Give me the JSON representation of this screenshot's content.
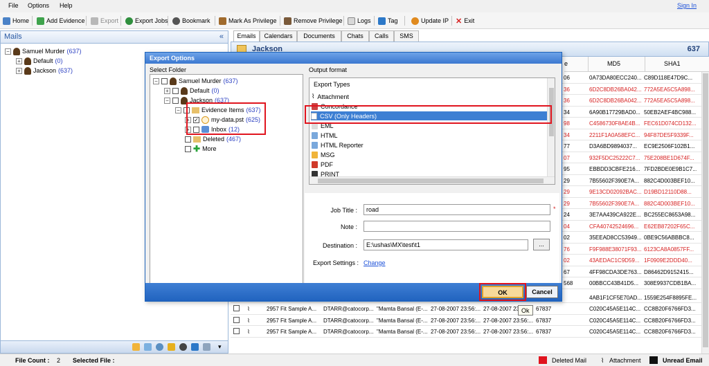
{
  "menu": {
    "file": "File",
    "options": "Options",
    "help": "Help",
    "sign_in": "Sign In"
  },
  "toolbar": {
    "home": "Home",
    "add_evidence": "Add Evidence",
    "export": "Export",
    "export_jobs": "Export Jobs",
    "bookmark": "Bookmark",
    "mark_privilege": "Mark As Privilege",
    "remove_privilege": "Remove Privilege",
    "logs": "Logs",
    "tag": "Tag",
    "update_ip": "Update IP",
    "exit": "Exit"
  },
  "mails": {
    "title": "Mails",
    "collapse": "«",
    "tree": [
      {
        "label": "Samuel Murder",
        "count": "(637)"
      },
      {
        "label": "Default",
        "count": "(0)"
      },
      {
        "label": "Jackson",
        "count": "(637)"
      }
    ]
  },
  "tabs": [
    "Emails",
    "Calendars",
    "Documents",
    "Chats",
    "Calls",
    "SMS"
  ],
  "folder_header": {
    "name": "Jackson",
    "count": "637"
  },
  "grid": {
    "col_e": "e",
    "md5": "MD5",
    "sha1": "SHA1",
    "rows": [
      {
        "size": "06",
        "md5": "0A73DA80ECC240...",
        "sha1": "C89D118E47D9C...",
        "red": false
      },
      {
        "size": "36",
        "md5": "6D2C8DB26BA042...",
        "sha1": "772A5EA5C5A898...",
        "red": true
      },
      {
        "size": "36",
        "md5": "6D2C8DB26BA042...",
        "sha1": "772A5EA5C5A898...",
        "red": true
      },
      {
        "size": "34",
        "md5": "6A90B17729BAD0...",
        "sha1": "50EB2AEF4BC988...",
        "red": false
      },
      {
        "size": "98",
        "md5": "C4586730F8AE4B...",
        "sha1": "FEC61D074CD132...",
        "red": true
      },
      {
        "size": "34",
        "md5": "2211F1A0A58EFC...",
        "sha1": "94F87DE5F9339F...",
        "red": true
      },
      {
        "size": "77",
        "md5": "D3A6BD9894037...",
        "sha1": "EC9E2506F102B1...",
        "red": false
      },
      {
        "size": "07",
        "md5": "932F5DC25222C7...",
        "sha1": "75E208BE1D674F...",
        "red": true
      },
      {
        "size": "95",
        "md5": "EBBDD3CBFE216...",
        "sha1": "7FD2BDE0E9B1C7...",
        "red": false
      },
      {
        "size": "29",
        "md5": "7B55602F390E7A...",
        "sha1": "882C4D003BEF10...",
        "red": false
      },
      {
        "size": "29",
        "md5": "9E13CD02092BAC...",
        "sha1": "D19BD12110D88...",
        "red": true
      },
      {
        "size": "29",
        "md5": "7B55602F390E7A...",
        "sha1": "882C4D003BEF10...",
        "red": true
      },
      {
        "size": "24",
        "md5": "3E7AA439CA922E...",
        "sha1": "BC255EC8653A98...",
        "red": false
      },
      {
        "size": "04",
        "md5": "CFA40742524696...",
        "sha1": "E62EB87202F65C...",
        "red": true
      },
      {
        "size": "02",
        "md5": "35EEAD8CC53949...",
        "sha1": "0BE9C56ABBBC8...",
        "red": false
      },
      {
        "size": "76",
        "md5": "F9F988E38071F93...",
        "sha1": "6123CA8A0857FF...",
        "red": true
      },
      {
        "size": "02",
        "md5": "43AEDAC1C9D59...",
        "sha1": "1F0909E2DDD40...",
        "red": true
      },
      {
        "size": "67",
        "md5": "4FF98CDA3DE763...",
        "sha1": "D86462D9152415...",
        "red": false
      },
      {
        "size": "568",
        "md5": "00BBCC43B41D5...",
        "sha1": "308E9937CDB1BA...",
        "red": false
      }
    ],
    "full_rows": [
      {
        "subject": "1411 Fit Sample A...",
        "from": "JGADD@catocorp...",
        "to": "\"Chandra Ray (E-...",
        "sent": "21-08-2007 23:56...",
        "recv": "21-08-2007 23:56...",
        "size": "73162",
        "md5": "4AB1F1CF5E70AD...",
        "sha1": "1559E254F8895FE..."
      },
      {
        "subject": "2957 Fit Sample A...",
        "from": "DTARR@catocorp...",
        "to": "\"Mamta Bansal (E-...",
        "sent": "27-08-2007 23:56:...",
        "recv": "27-08-2007 23:56:...",
        "size": "67837",
        "md5": "C020C45A5E114C...",
        "sha1": "CC8B20F6766FD3..."
      },
      {
        "subject": "2957 Fit Sample A...",
        "from": "DTARR@catocorp...",
        "to": "\"Mamta Bansal (E-...",
        "sent": "27-08-2007 23:56:...",
        "recv": "27-08-2007 23:56:...",
        "size": "67837",
        "md5": "C020C45A5E114C...",
        "sha1": "CC8B20F6766FD3..."
      },
      {
        "subject": "2957 Fit Sample A...",
        "from": "DTARR@catocorp...",
        "to": "\"Mamta Bansal (E-...",
        "sent": "27-08-2007 23:56:...",
        "recv": "27-08-2007 23:56:...",
        "size": "67837",
        "md5": "C020C45A5E114C...",
        "sha1": "CC8B20F6766FD3..."
      }
    ]
  },
  "status": {
    "file_count_label": "File Count :",
    "file_count": "2",
    "selected_file_label": "Selected File :",
    "deleted_mail": "Deleted Mail",
    "attachment": "Attachment",
    "unread_email": "Unread Email",
    "deleted_color": "#e0141e",
    "unread_color": "#111111"
  },
  "dialog": {
    "title": "Export Options",
    "select_folder": "Select Folder",
    "output_format": "Output format",
    "tree": {
      "root": {
        "label": "Samuel Murder",
        "count": "(637)"
      },
      "default": {
        "label": "Default",
        "count": "(0)"
      },
      "jackson": {
        "label": "Jackson",
        "count": "(637)"
      },
      "evidence_items": {
        "label": "Evidence Items",
        "count": "(637)"
      },
      "mydata": {
        "label": "my-data.pst",
        "count": "(625)"
      },
      "inbox": {
        "label": "Inbox",
        "count": "(12)"
      },
      "deleted": {
        "label": "Deleted",
        "count": "(467)"
      },
      "more": {
        "label": "More"
      }
    },
    "export_types_header": "Export Types",
    "export_types": [
      "Attachment",
      "Concordance",
      "CSV (Only Headers)",
      "EML",
      "HTML",
      "HTML Reporter",
      "MSG",
      "PDF",
      "PRINT"
    ],
    "selected_type": "CSV (Only Headers)",
    "job_title_label": "Job Title :",
    "job_title_value": "road",
    "required_mark": "*",
    "note_label": "Note :",
    "note_value": "",
    "destination_label": "Destination :",
    "destination_value": "E:\\ushas\\MX\\test\\t1",
    "browse": "...",
    "export_settings_label": "Export Settings :",
    "change_link": "Change",
    "ok": "OK",
    "cancel": "Cancel",
    "tooltip": "Ok"
  }
}
